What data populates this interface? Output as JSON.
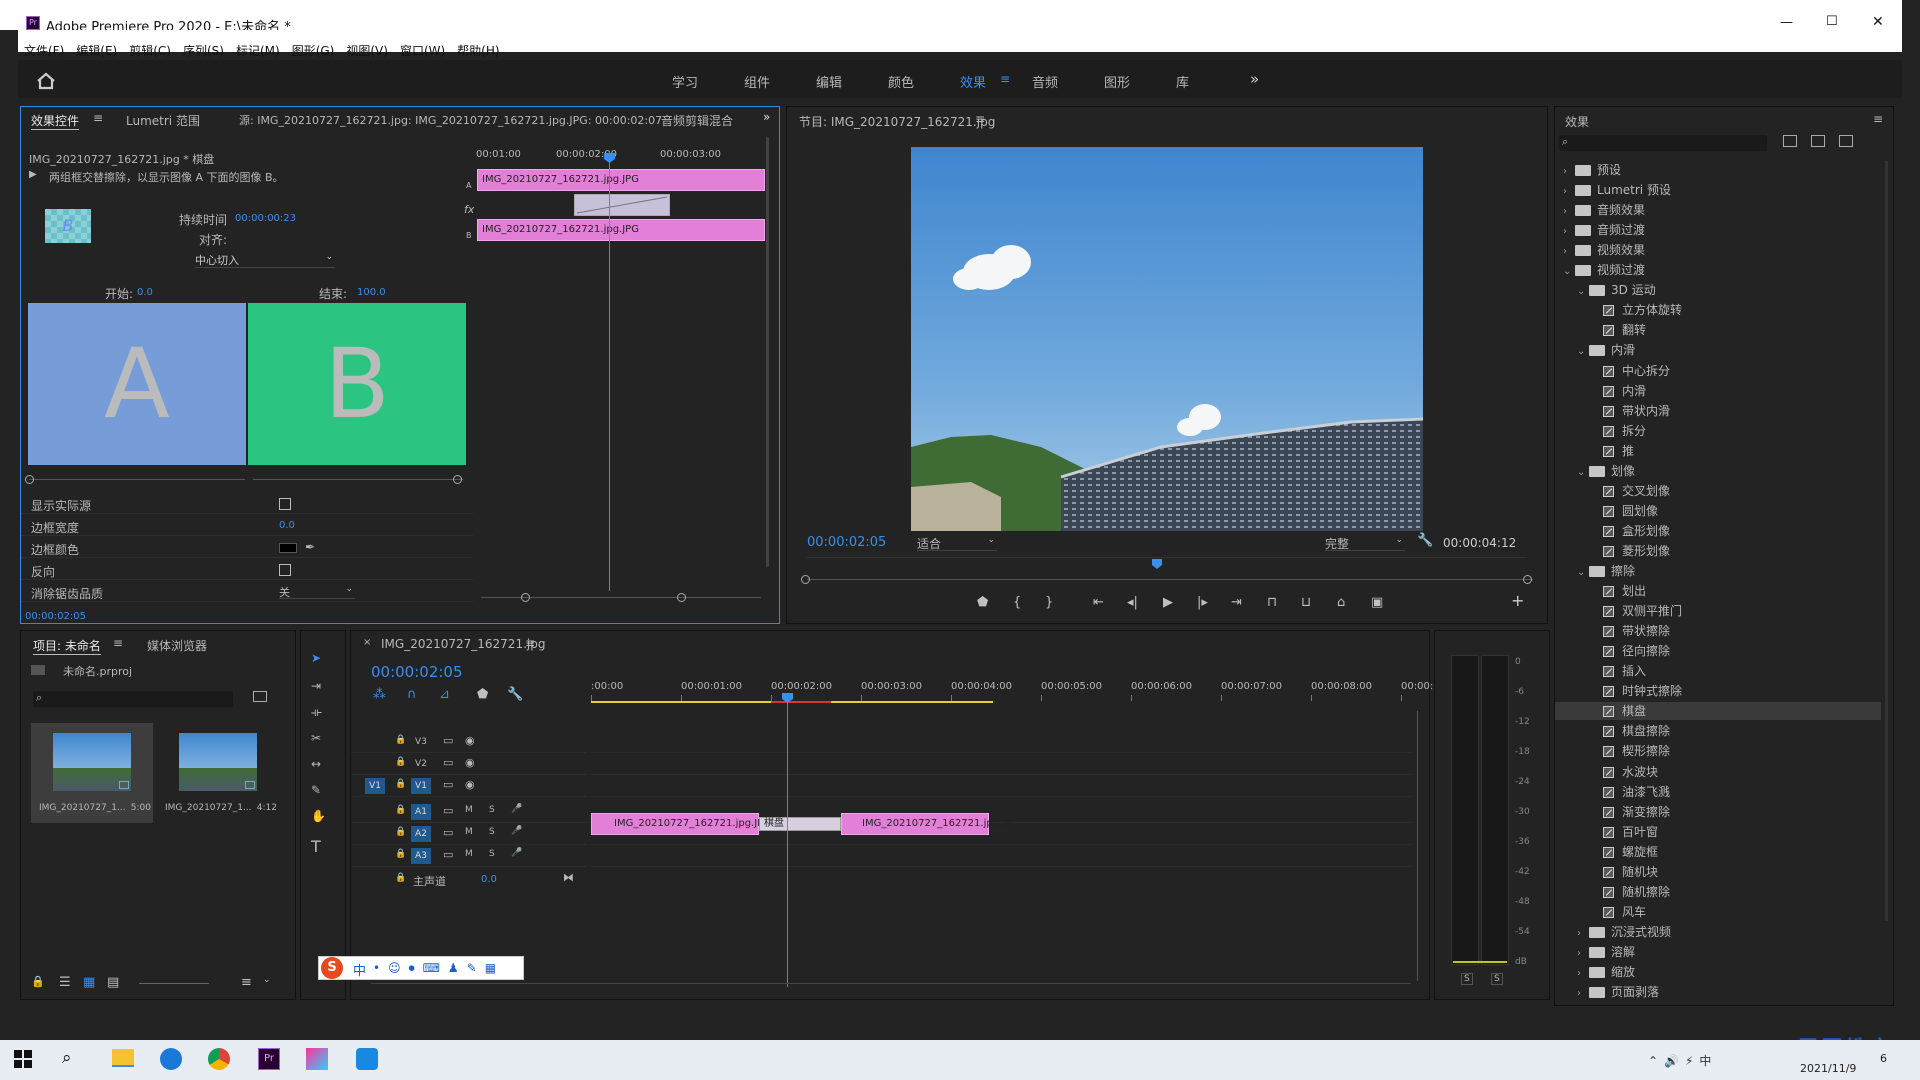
{
  "titlebar": {
    "title": "Adobe Premiere Pro 2020 - E:\\未命名 *",
    "minimize": "—",
    "maximize": "☐",
    "close": "✕"
  },
  "menu": [
    "文件(F)",
    "编辑(E)",
    "剪辑(C)",
    "序列(S)",
    "标记(M)",
    "图形(G)",
    "视图(V)",
    "窗口(W)",
    "帮助(H)"
  ],
  "workspaces": [
    "学习",
    "组件",
    "编辑",
    "颜色",
    "效果",
    "音频",
    "图形",
    "库"
  ],
  "workspace_active": "效果",
  "workspace_more": "»",
  "source_panel": {
    "tabs": [
      "效果控件",
      "Lumetri 范围",
      "源: IMG_20210727_162721.jpg: IMG_20210727_162721.jpg.JPG: 00:00:02:07",
      "音频剪辑混合"
    ],
    "clip_title": "IMG_20210727_162721.jpg * 棋盘",
    "description": "两组框交替擦除，以显示图像 A 下面的图像 B。",
    "thumb_letter": "B",
    "duration_label": "持续时间",
    "duration_value": "00:00:00:23",
    "align_label": "对齐:",
    "align_value": "中心切入",
    "start_label": "开始:",
    "start_value": "0.0",
    "end_label": "结束:",
    "end_value": "100.0",
    "preview_a": "A",
    "preview_b": "B",
    "props": [
      {
        "label": "显示实际源",
        "type": "checkbox"
      },
      {
        "label": "边框宽度",
        "type": "value",
        "value": "0.0"
      },
      {
        "label": "边框颜色",
        "type": "color"
      },
      {
        "label": "反向",
        "type": "checkbox"
      },
      {
        "label": "消除锯齿品质",
        "type": "select",
        "value": "关"
      }
    ],
    "mini_ruler": [
      "00:01:00",
      "00:00:02:00",
      "00:00:03:00"
    ],
    "clip_a": "IMG_20210727_162721.jpg.JPG",
    "clip_b": "IMG_20210727_162721.jpg.JPG",
    "track_a": "A",
    "track_b": "B",
    "fx": "fx",
    "time": "00:00:02:05"
  },
  "program": {
    "title": "节目: IMG_20210727_162721.jpg",
    "timecode": "00:00:02:05",
    "fit": "适合",
    "quality": "完整",
    "duration": "00:00:04:12",
    "add": "+"
  },
  "effects_panel": {
    "title": "效果",
    "tree": [
      {
        "level": 0,
        "kind": "folder",
        "label": "预设",
        "open": false
      },
      {
        "level": 0,
        "kind": "folder",
        "label": "Lumetri 预设",
        "open": false
      },
      {
        "level": 0,
        "kind": "folder",
        "label": "音频效果",
        "open": false
      },
      {
        "level": 0,
        "kind": "folder",
        "label": "音频过渡",
        "open": false
      },
      {
        "level": 0,
        "kind": "folder",
        "label": "视频效果",
        "open": false
      },
      {
        "level": 0,
        "kind": "folder",
        "label": "视频过渡",
        "open": true
      },
      {
        "level": 1,
        "kind": "folder",
        "label": "3D 运动",
        "open": true
      },
      {
        "level": 2,
        "kind": "effect",
        "label": "立方体旋转"
      },
      {
        "level": 2,
        "kind": "effect",
        "label": "翻转"
      },
      {
        "level": 1,
        "kind": "folder",
        "label": "内滑",
        "open": true
      },
      {
        "level": 2,
        "kind": "effect",
        "label": "中心拆分"
      },
      {
        "level": 2,
        "kind": "effect",
        "label": "内滑"
      },
      {
        "level": 2,
        "kind": "effect",
        "label": "带状内滑"
      },
      {
        "level": 2,
        "kind": "effect",
        "label": "拆分"
      },
      {
        "level": 2,
        "kind": "effect",
        "label": "推"
      },
      {
        "level": 1,
        "kind": "folder",
        "label": "划像",
        "open": true
      },
      {
        "level": 2,
        "kind": "effect",
        "label": "交叉划像"
      },
      {
        "level": 2,
        "kind": "effect",
        "label": "圆划像"
      },
      {
        "level": 2,
        "kind": "effect",
        "label": "盒形划像"
      },
      {
        "level": 2,
        "kind": "effect",
        "label": "菱形划像"
      },
      {
        "level": 1,
        "kind": "folder",
        "label": "擦除",
        "open": true
      },
      {
        "level": 2,
        "kind": "effect",
        "label": "划出"
      },
      {
        "level": 2,
        "kind": "effect",
        "label": "双侧平推门"
      },
      {
        "level": 2,
        "kind": "effect",
        "label": "带状擦除"
      },
      {
        "level": 2,
        "kind": "effect",
        "label": "径向擦除"
      },
      {
        "level": 2,
        "kind": "effect",
        "label": "插入"
      },
      {
        "level": 2,
        "kind": "effect",
        "label": "时钟式擦除"
      },
      {
        "level": 2,
        "kind": "effect",
        "label": "棋盘",
        "selected": true
      },
      {
        "level": 2,
        "kind": "effect",
        "label": "棋盘擦除"
      },
      {
        "level": 2,
        "kind": "effect",
        "label": "楔形擦除"
      },
      {
        "level": 2,
        "kind": "effect",
        "label": "水波块"
      },
      {
        "level": 2,
        "kind": "effect",
        "label": "油漆飞溅"
      },
      {
        "level": 2,
        "kind": "effect",
        "label": "渐变擦除"
      },
      {
        "level": 2,
        "kind": "effect",
        "label": "百叶窗"
      },
      {
        "level": 2,
        "kind": "effect",
        "label": "螺旋框"
      },
      {
        "level": 2,
        "kind": "effect",
        "label": "随机块"
      },
      {
        "level": 2,
        "kind": "effect",
        "label": "随机擦除"
      },
      {
        "level": 2,
        "kind": "effect",
        "label": "风车"
      },
      {
        "level": 1,
        "kind": "folder",
        "label": "沉浸式视频",
        "open": false
      },
      {
        "level": 1,
        "kind": "folder",
        "label": "溶解",
        "open": false
      },
      {
        "level": 1,
        "kind": "folder",
        "label": "缩放",
        "open": false
      },
      {
        "level": 1,
        "kind": "folder",
        "label": "页面剥落",
        "open": false
      }
    ]
  },
  "project": {
    "tabs": [
      "项目: 未命名",
      "媒体浏览器"
    ],
    "file": "未命名.prproj",
    "items": [
      {
        "name": "IMG_20210727_1...",
        "dur": "5:00"
      },
      {
        "name": "IMG_20210727_1...",
        "dur": "4:12"
      }
    ]
  },
  "timeline": {
    "tab": "IMG_20210727_162721.jpg",
    "timecode": "00:00:02:05",
    "ruler": [
      ":00:00",
      "00:00:01:00",
      "00:00:02:00",
      "00:00:03:00",
      "00:00:04:00",
      "00:00:05:00",
      "00:00:06:00",
      "00:00:07:00",
      "00:00:08:00",
      "00:00:0"
    ],
    "video_tracks": [
      "V3",
      "V2",
      "V1"
    ],
    "audio_tracks": [
      "A1",
      "A2",
      "A3"
    ],
    "src_v1": "V1",
    "m": "M",
    "s": "S",
    "master": "主声道",
    "master_val": "0.0",
    "clip1": "IMG_20210727_162721.jpg.JPG",
    "transition": "棋盘",
    "clip2": "IMG_20210727_162721.jpg.JP"
  },
  "meter": {
    "scale": [
      "0",
      "-6",
      "-12",
      "-18",
      "-24",
      "-30",
      "-36",
      "-42",
      "-48",
      "-54",
      "dB"
    ],
    "s": "S"
  },
  "ime": {
    "label": "中"
  },
  "watermark": "最需教育",
  "taskbar": {
    "time": "2021/11/9",
    "notify": "6"
  },
  "colors": {
    "accent": "#2d8ceb",
    "clip": "#e27fd7",
    "panel": "#232323",
    "green": "#2bc481",
    "slateblue": "#779dd9"
  }
}
